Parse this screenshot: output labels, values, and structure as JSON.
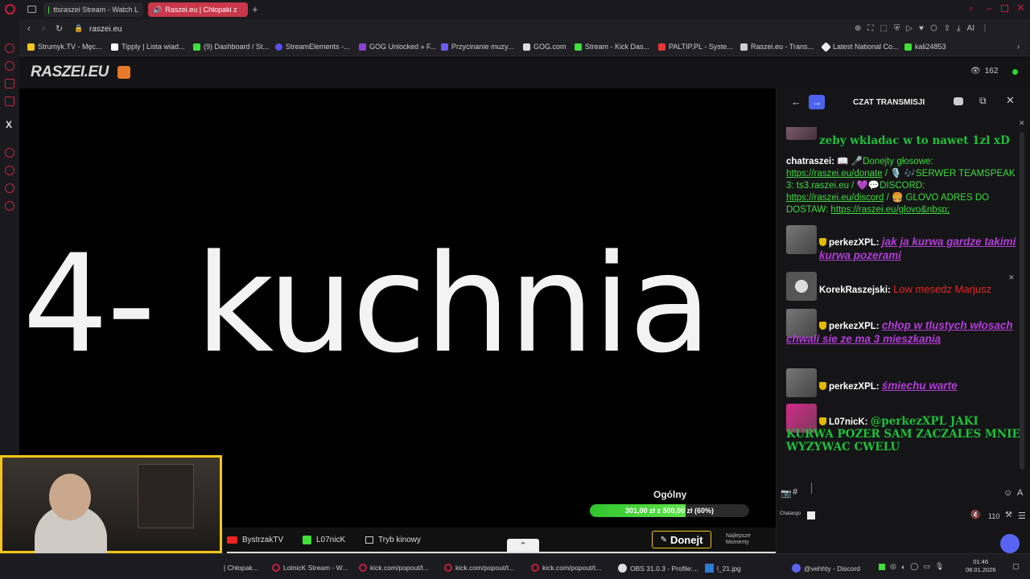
{
  "tabs": [
    {
      "label": "ttsraszei Stream - Watch L",
      "active": false
    },
    {
      "label": "Raszei.eu | Chłopaki z",
      "active": true
    }
  ],
  "address": "raszei.eu",
  "bookmarks": [
    "Strumyk.TV - Męc...",
    "Tipply | Lista wiad...",
    "(9) Dashboard / St...",
    "StreamElements -...",
    "GOG Unlocked » F...",
    "Przycinanie muzy...",
    "GOG.com",
    "Stream - Kick Das...",
    "PALTIP.PL - Syste...",
    "Raszei.eu - Trans...",
    "Latest National Co...",
    "kali24853"
  ],
  "site": {
    "logo": "RASZEI.EU",
    "viewers": "162"
  },
  "video": {
    "title": "4- kuchnia",
    "goal_label": "Ogólny",
    "goal_text": "301,00 zł z 500,00 zł (60%)",
    "goal_progress": 0.6
  },
  "controls": {
    "channel1": "BystrzakTV",
    "channel2": "L07nicK",
    "cinema": "Tryb kinowy",
    "donate": "Donejt",
    "best": "Najlepsze Momenty"
  },
  "chat": {
    "title": "CZAT TRANSMISJI",
    "top_cut": "zeby wkladac w to nawet 1zl xD",
    "system": {
      "name": "chatraszei:",
      "t1": "📖 🎤Donejty głosowe:",
      "link1": "https://raszei.eu/donate",
      "t2": " / 🎙️ 🎶SERWER TEAMSPEAK 3: ts3.raszei.eu /   💜💬DISCORD:",
      "link2": "https://raszei.eu/discord",
      "t3": " / 🍔 GLOVO ADRES DO DOSTAW:",
      "link3": "https://raszei.eu/glovo&nbsp;"
    },
    "messages": [
      {
        "user": "perkezXPL:",
        "text": "jak ja kurwa gardze takimi kurwa pozerami",
        "style": "purple"
      },
      {
        "user": "KorekRaszejski:",
        "text": "Low mesedz Marjusz",
        "style": "red"
      },
      {
        "user": "perkezXPL:",
        "text": "chłop w tlustych włosach chwali sie ze ma 3 mieszkania",
        "style": "purple"
      },
      {
        "user": "perkezXPL:",
        "text": "śmiechu warte",
        "style": "purple"
      },
      {
        "user": "L07nicK:",
        "text": "@perkezXPL JAKI KURWA POZER SAM ZACZALES MNIE WYZYWAC CWELU",
        "style": "green"
      }
    ],
    "chatango": "Chatango",
    "volume": "110"
  },
  "taskbar": {
    "items": [
      "| Chłopak...",
      "LotnicK Stream - W...",
      "kick.com/popout/l...",
      "kick.com/popout/t...",
      "kick.com/popout/t...",
      "OBS 31.0.3 - Profile:...",
      "l_21.jpg",
      "@vehhty - Discord"
    ],
    "time": "01:46",
    "date": "08.01.2026"
  },
  "colors": {
    "accent": "#c41e3a",
    "goal": "#3fcf34",
    "donate": "#f5c518",
    "nav_blue": "#4d63f0"
  }
}
